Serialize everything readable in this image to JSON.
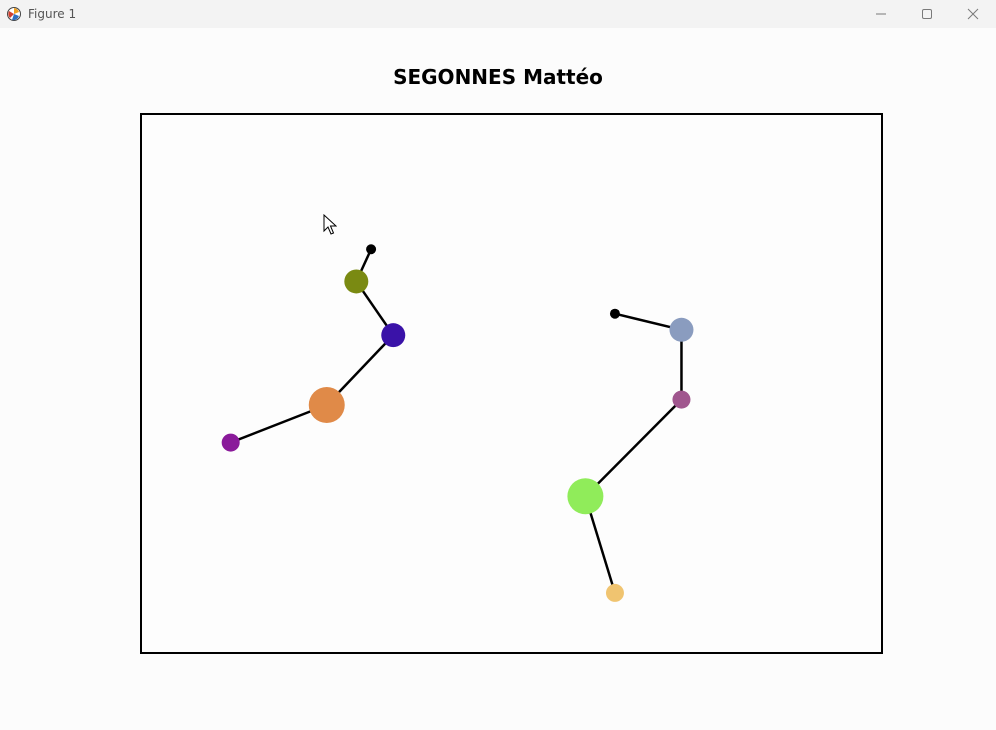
{
  "window": {
    "title": "Figure 1",
    "icon": "matplotlib-icon",
    "controls": [
      "minimize-icon",
      "maximize-icon",
      "close-icon"
    ]
  },
  "figure": {
    "title": "SEGONNES Mattéo"
  },
  "chart_data": {
    "type": "scatter",
    "title": "SEGONNES Mattéo",
    "xlabel": "",
    "ylabel": "",
    "axes_visible": false,
    "xlim": [
      0,
      10
    ],
    "ylim": [
      0,
      10
    ],
    "series": [
      {
        "nodes": [
          {
            "x": 3.1,
            "y": 7.5,
            "size": "small",
            "color": "#000000"
          },
          {
            "x": 2.9,
            "y": 6.9,
            "size": "medium",
            "color": "#7a8a12"
          },
          {
            "x": 3.4,
            "y": 5.9,
            "size": "medium",
            "color": "#3a12a8"
          },
          {
            "x": 2.5,
            "y": 4.6,
            "size": "large",
            "color": "#e08a48"
          },
          {
            "x": 1.2,
            "y": 3.9,
            "size": "medium-small",
            "color": "#8a1a9a"
          }
        ]
      },
      {
        "nodes": [
          {
            "x": 6.4,
            "y": 6.3,
            "size": "small",
            "color": "#000000"
          },
          {
            "x": 7.3,
            "y": 6.0,
            "size": "medium",
            "color": "#8a9cbf"
          },
          {
            "x": 7.3,
            "y": 4.7,
            "size": "medium-small",
            "color": "#a0568e"
          },
          {
            "x": 6.0,
            "y": 2.9,
            "size": "large",
            "color": "#90ec5a"
          },
          {
            "x": 6.4,
            "y": 1.1,
            "size": "medium-small",
            "color": "#f0c470"
          }
        ]
      }
    ]
  }
}
